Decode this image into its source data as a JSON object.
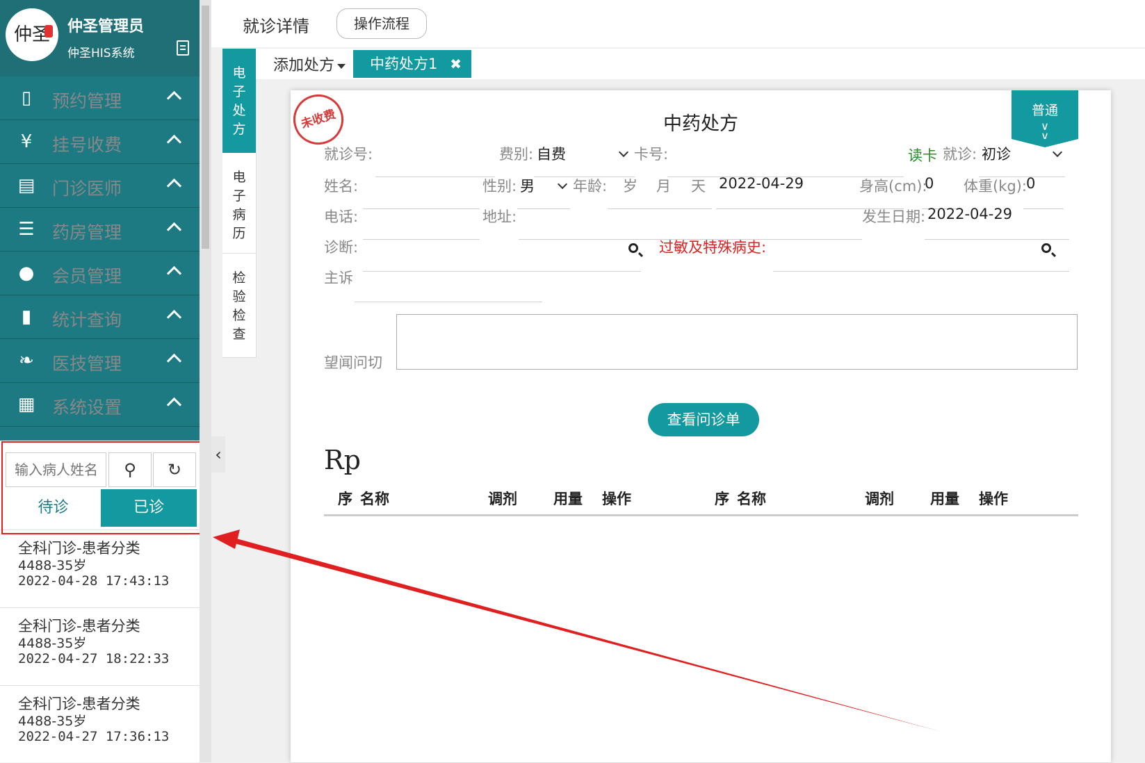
{
  "profile": {
    "avatar_text": "仲圣",
    "user_name": "仲圣管理员",
    "system_name": "仲圣HIS系统"
  },
  "menu": [
    {
      "icon": "phone-icon",
      "glyph": "▯",
      "label": "预约管理"
    },
    {
      "icon": "yen-icon",
      "glyph": "¥",
      "label": "挂号收费"
    },
    {
      "icon": "list-icon",
      "glyph": "▤",
      "label": "门诊医师"
    },
    {
      "icon": "list-bullets-icon",
      "glyph": "☰",
      "label": "药房管理"
    },
    {
      "icon": "user-icon",
      "glyph": "●",
      "label": "会员管理"
    },
    {
      "icon": "bar-chart-icon",
      "glyph": "▮",
      "label": "统计查询"
    },
    {
      "icon": "leaf-icon",
      "glyph": "❧",
      "label": "医技管理"
    },
    {
      "icon": "grid-icon",
      "glyph": "▦",
      "label": "系统设置"
    }
  ],
  "patient_search": {
    "placeholder": "输入病人姓名",
    "search_icon": "search-icon",
    "refresh_icon": "refresh-icon"
  },
  "status_tabs": {
    "waiting": "待诊",
    "done": "已诊"
  },
  "patients": [
    {
      "dept": "全科门诊-患者分类",
      "info": "4488-35岁",
      "time": "2022-04-28 17:43:13"
    },
    {
      "dept": "全科门诊-患者分类",
      "info": "4488-35岁",
      "time": "2022-04-27 18:22:33"
    },
    {
      "dept": "全科门诊-患者分类",
      "info": "4488-35岁",
      "time": "2022-04-27 17:36:13"
    }
  ],
  "header": {
    "title": "就诊详情",
    "flow_button": "操作流程"
  },
  "vertical_tabs": [
    {
      "label": "电子处方",
      "active": true
    },
    {
      "label": "电子病历",
      "active": false
    },
    {
      "label": "检验检查",
      "active": false
    }
  ],
  "rx_tabs": {
    "add_label": "添加处方",
    "current": "中药处方1",
    "close_icon": "close-icon"
  },
  "card": {
    "stamp": "未收费",
    "title": "中药处方",
    "ribbon": "普通",
    "fields": {
      "visit_no_label": "就诊号:",
      "fee_type_label": "费别:",
      "fee_type_value": "自费",
      "card_no_label": "卡号:",
      "read_card": "读卡",
      "visit_type_label": "就诊:",
      "visit_type_value": "初诊",
      "name_label": "姓名:",
      "gender_label": "性别:",
      "gender_value": "男",
      "age_label": "年龄:",
      "age_year": "岁",
      "age_month": "月",
      "age_day": "天",
      "visit_date": "2022-04-29",
      "height_label": "身高(cm):",
      "height_value": "0",
      "weight_label": "体重(kg):",
      "weight_value": "0",
      "phone_label": "电话:",
      "address_label": "地址:",
      "occur_date_label": "发生日期:",
      "occur_date_value": "2022-04-29",
      "diagnosis_label": "诊断:",
      "allergy_label": "过敏及特殊病史:",
      "complaint_label": "主诉",
      "tcm_label": "望闻问切"
    },
    "view_button": "查看问诊单",
    "rp": "Rp",
    "table_headers": [
      "序",
      "名称",
      "调剂",
      "用量",
      "操作",
      "序",
      "名称",
      "调剂",
      "用量",
      "操作"
    ]
  },
  "colors": {
    "teal": "#139aa0",
    "menu_bg": "#1d7a82",
    "annotation_red": "#e02020"
  }
}
